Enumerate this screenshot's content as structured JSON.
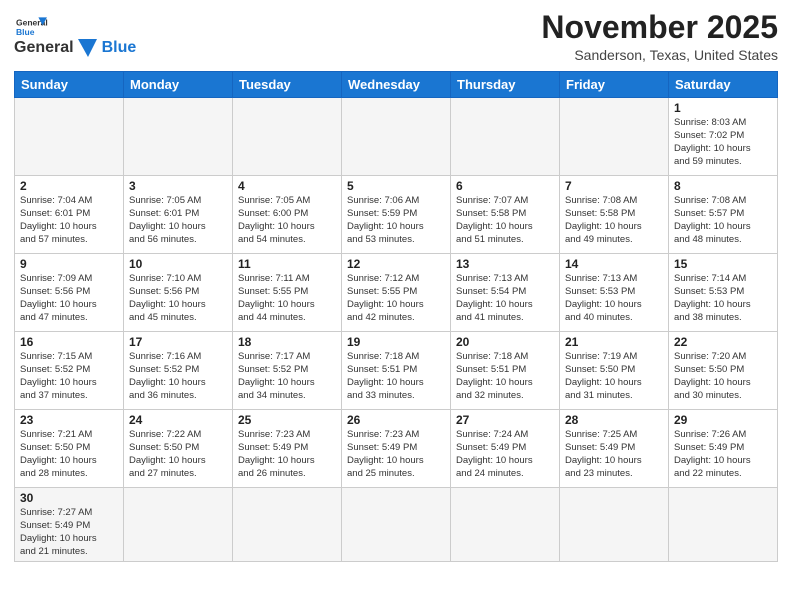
{
  "header": {
    "logo_general": "General",
    "logo_blue": "Blue",
    "month_title": "November 2025",
    "location": "Sanderson, Texas, United States"
  },
  "weekdays": [
    "Sunday",
    "Monday",
    "Tuesday",
    "Wednesday",
    "Thursday",
    "Friday",
    "Saturday"
  ],
  "weeks": [
    [
      {
        "day": "",
        "info": ""
      },
      {
        "day": "",
        "info": ""
      },
      {
        "day": "",
        "info": ""
      },
      {
        "day": "",
        "info": ""
      },
      {
        "day": "",
        "info": ""
      },
      {
        "day": "",
        "info": ""
      },
      {
        "day": "1",
        "info": "Sunrise: 8:03 AM\nSunset: 7:02 PM\nDaylight: 10 hours\nand 59 minutes."
      }
    ],
    [
      {
        "day": "2",
        "info": "Sunrise: 7:04 AM\nSunset: 6:01 PM\nDaylight: 10 hours\nand 57 minutes."
      },
      {
        "day": "3",
        "info": "Sunrise: 7:05 AM\nSunset: 6:01 PM\nDaylight: 10 hours\nand 56 minutes."
      },
      {
        "day": "4",
        "info": "Sunrise: 7:05 AM\nSunset: 6:00 PM\nDaylight: 10 hours\nand 54 minutes."
      },
      {
        "day": "5",
        "info": "Sunrise: 7:06 AM\nSunset: 5:59 PM\nDaylight: 10 hours\nand 53 minutes."
      },
      {
        "day": "6",
        "info": "Sunrise: 7:07 AM\nSunset: 5:58 PM\nDaylight: 10 hours\nand 51 minutes."
      },
      {
        "day": "7",
        "info": "Sunrise: 7:08 AM\nSunset: 5:58 PM\nDaylight: 10 hours\nand 49 minutes."
      },
      {
        "day": "8",
        "info": "Sunrise: 7:08 AM\nSunset: 5:57 PM\nDaylight: 10 hours\nand 48 minutes."
      }
    ],
    [
      {
        "day": "9",
        "info": "Sunrise: 7:09 AM\nSunset: 5:56 PM\nDaylight: 10 hours\nand 47 minutes."
      },
      {
        "day": "10",
        "info": "Sunrise: 7:10 AM\nSunset: 5:56 PM\nDaylight: 10 hours\nand 45 minutes."
      },
      {
        "day": "11",
        "info": "Sunrise: 7:11 AM\nSunset: 5:55 PM\nDaylight: 10 hours\nand 44 minutes."
      },
      {
        "day": "12",
        "info": "Sunrise: 7:12 AM\nSunset: 5:55 PM\nDaylight: 10 hours\nand 42 minutes."
      },
      {
        "day": "13",
        "info": "Sunrise: 7:13 AM\nSunset: 5:54 PM\nDaylight: 10 hours\nand 41 minutes."
      },
      {
        "day": "14",
        "info": "Sunrise: 7:13 AM\nSunset: 5:53 PM\nDaylight: 10 hours\nand 40 minutes."
      },
      {
        "day": "15",
        "info": "Sunrise: 7:14 AM\nSunset: 5:53 PM\nDaylight: 10 hours\nand 38 minutes."
      }
    ],
    [
      {
        "day": "16",
        "info": "Sunrise: 7:15 AM\nSunset: 5:52 PM\nDaylight: 10 hours\nand 37 minutes."
      },
      {
        "day": "17",
        "info": "Sunrise: 7:16 AM\nSunset: 5:52 PM\nDaylight: 10 hours\nand 36 minutes."
      },
      {
        "day": "18",
        "info": "Sunrise: 7:17 AM\nSunset: 5:52 PM\nDaylight: 10 hours\nand 34 minutes."
      },
      {
        "day": "19",
        "info": "Sunrise: 7:18 AM\nSunset: 5:51 PM\nDaylight: 10 hours\nand 33 minutes."
      },
      {
        "day": "20",
        "info": "Sunrise: 7:18 AM\nSunset: 5:51 PM\nDaylight: 10 hours\nand 32 minutes."
      },
      {
        "day": "21",
        "info": "Sunrise: 7:19 AM\nSunset: 5:50 PM\nDaylight: 10 hours\nand 31 minutes."
      },
      {
        "day": "22",
        "info": "Sunrise: 7:20 AM\nSunset: 5:50 PM\nDaylight: 10 hours\nand 30 minutes."
      }
    ],
    [
      {
        "day": "23",
        "info": "Sunrise: 7:21 AM\nSunset: 5:50 PM\nDaylight: 10 hours\nand 28 minutes."
      },
      {
        "day": "24",
        "info": "Sunrise: 7:22 AM\nSunset: 5:50 PM\nDaylight: 10 hours\nand 27 minutes."
      },
      {
        "day": "25",
        "info": "Sunrise: 7:23 AM\nSunset: 5:49 PM\nDaylight: 10 hours\nand 26 minutes."
      },
      {
        "day": "26",
        "info": "Sunrise: 7:23 AM\nSunset: 5:49 PM\nDaylight: 10 hours\nand 25 minutes."
      },
      {
        "day": "27",
        "info": "Sunrise: 7:24 AM\nSunset: 5:49 PM\nDaylight: 10 hours\nand 24 minutes."
      },
      {
        "day": "28",
        "info": "Sunrise: 7:25 AM\nSunset: 5:49 PM\nDaylight: 10 hours\nand 23 minutes."
      },
      {
        "day": "29",
        "info": "Sunrise: 7:26 AM\nSunset: 5:49 PM\nDaylight: 10 hours\nand 22 minutes."
      }
    ],
    [
      {
        "day": "30",
        "info": "Sunrise: 7:27 AM\nSunset: 5:49 PM\nDaylight: 10 hours\nand 21 minutes."
      },
      {
        "day": "",
        "info": ""
      },
      {
        "day": "",
        "info": ""
      },
      {
        "day": "",
        "info": ""
      },
      {
        "day": "",
        "info": ""
      },
      {
        "day": "",
        "info": ""
      },
      {
        "day": "",
        "info": ""
      }
    ]
  ]
}
